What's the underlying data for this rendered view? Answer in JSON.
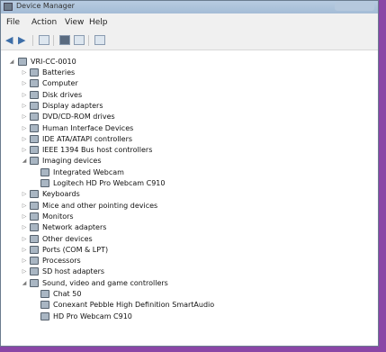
{
  "window": {
    "title": "Device Manager"
  },
  "menu": [
    "File",
    "Action",
    "View",
    "Help"
  ],
  "tree": {
    "root": "VRI-CC-0010",
    "items": [
      {
        "label": "Batteries",
        "icon": "battery-icon",
        "state": "collapsed",
        "level": 1
      },
      {
        "label": "Computer",
        "icon": "computer-icon",
        "state": "collapsed",
        "level": 1
      },
      {
        "label": "Disk drives",
        "icon": "disk-drive-icon",
        "state": "collapsed",
        "level": 1
      },
      {
        "label": "Display adapters",
        "icon": "display-adapter-icon",
        "state": "collapsed",
        "level": 1
      },
      {
        "label": "DVD/CD-ROM drives",
        "icon": "dvd-drive-icon",
        "state": "collapsed",
        "level": 1
      },
      {
        "label": "Human Interface Devices",
        "icon": "hid-icon",
        "state": "collapsed",
        "level": 1
      },
      {
        "label": "IDE ATA/ATAPI controllers",
        "icon": "ide-controller-icon",
        "state": "collapsed",
        "level": 1
      },
      {
        "label": "IEEE 1394 Bus host controllers",
        "icon": "firewire-icon",
        "state": "collapsed",
        "level": 1
      },
      {
        "label": "Imaging devices",
        "icon": "camera-icon",
        "state": "expanded",
        "level": 1
      },
      {
        "label": "Integrated Webcam",
        "icon": "webcam-icon",
        "state": "leaf",
        "level": 2
      },
      {
        "label": "Logitech HD Pro Webcam C910",
        "icon": "webcam-icon",
        "state": "leaf",
        "level": 2
      },
      {
        "label": "Keyboards",
        "icon": "keyboard-icon",
        "state": "collapsed",
        "level": 1
      },
      {
        "label": "Mice and other pointing devices",
        "icon": "mouse-icon",
        "state": "collapsed",
        "level": 1
      },
      {
        "label": "Monitors",
        "icon": "monitor-icon",
        "state": "collapsed",
        "level": 1
      },
      {
        "label": "Network adapters",
        "icon": "network-adapter-icon",
        "state": "collapsed",
        "level": 1
      },
      {
        "label": "Other devices",
        "icon": "other-devices-icon",
        "state": "collapsed",
        "level": 1
      },
      {
        "label": "Ports (COM & LPT)",
        "icon": "port-icon",
        "state": "collapsed",
        "level": 1
      },
      {
        "label": "Processors",
        "icon": "processor-icon",
        "state": "collapsed",
        "level": 1
      },
      {
        "label": "SD host adapters",
        "icon": "sd-adapter-icon",
        "state": "collapsed",
        "level": 1
      },
      {
        "label": "Sound, video and game controllers",
        "icon": "speaker-icon",
        "state": "expanded",
        "level": 1
      },
      {
        "label": "Chat 50",
        "icon": "speaker-icon",
        "state": "leaf",
        "level": 2
      },
      {
        "label": "Conexant Pebble High Definition SmartAudio",
        "icon": "audio-device-icon",
        "state": "leaf",
        "level": 2
      },
      {
        "label": "HD Pro Webcam C910",
        "icon": "audio-device-icon",
        "state": "leaf",
        "level": 2
      }
    ]
  }
}
